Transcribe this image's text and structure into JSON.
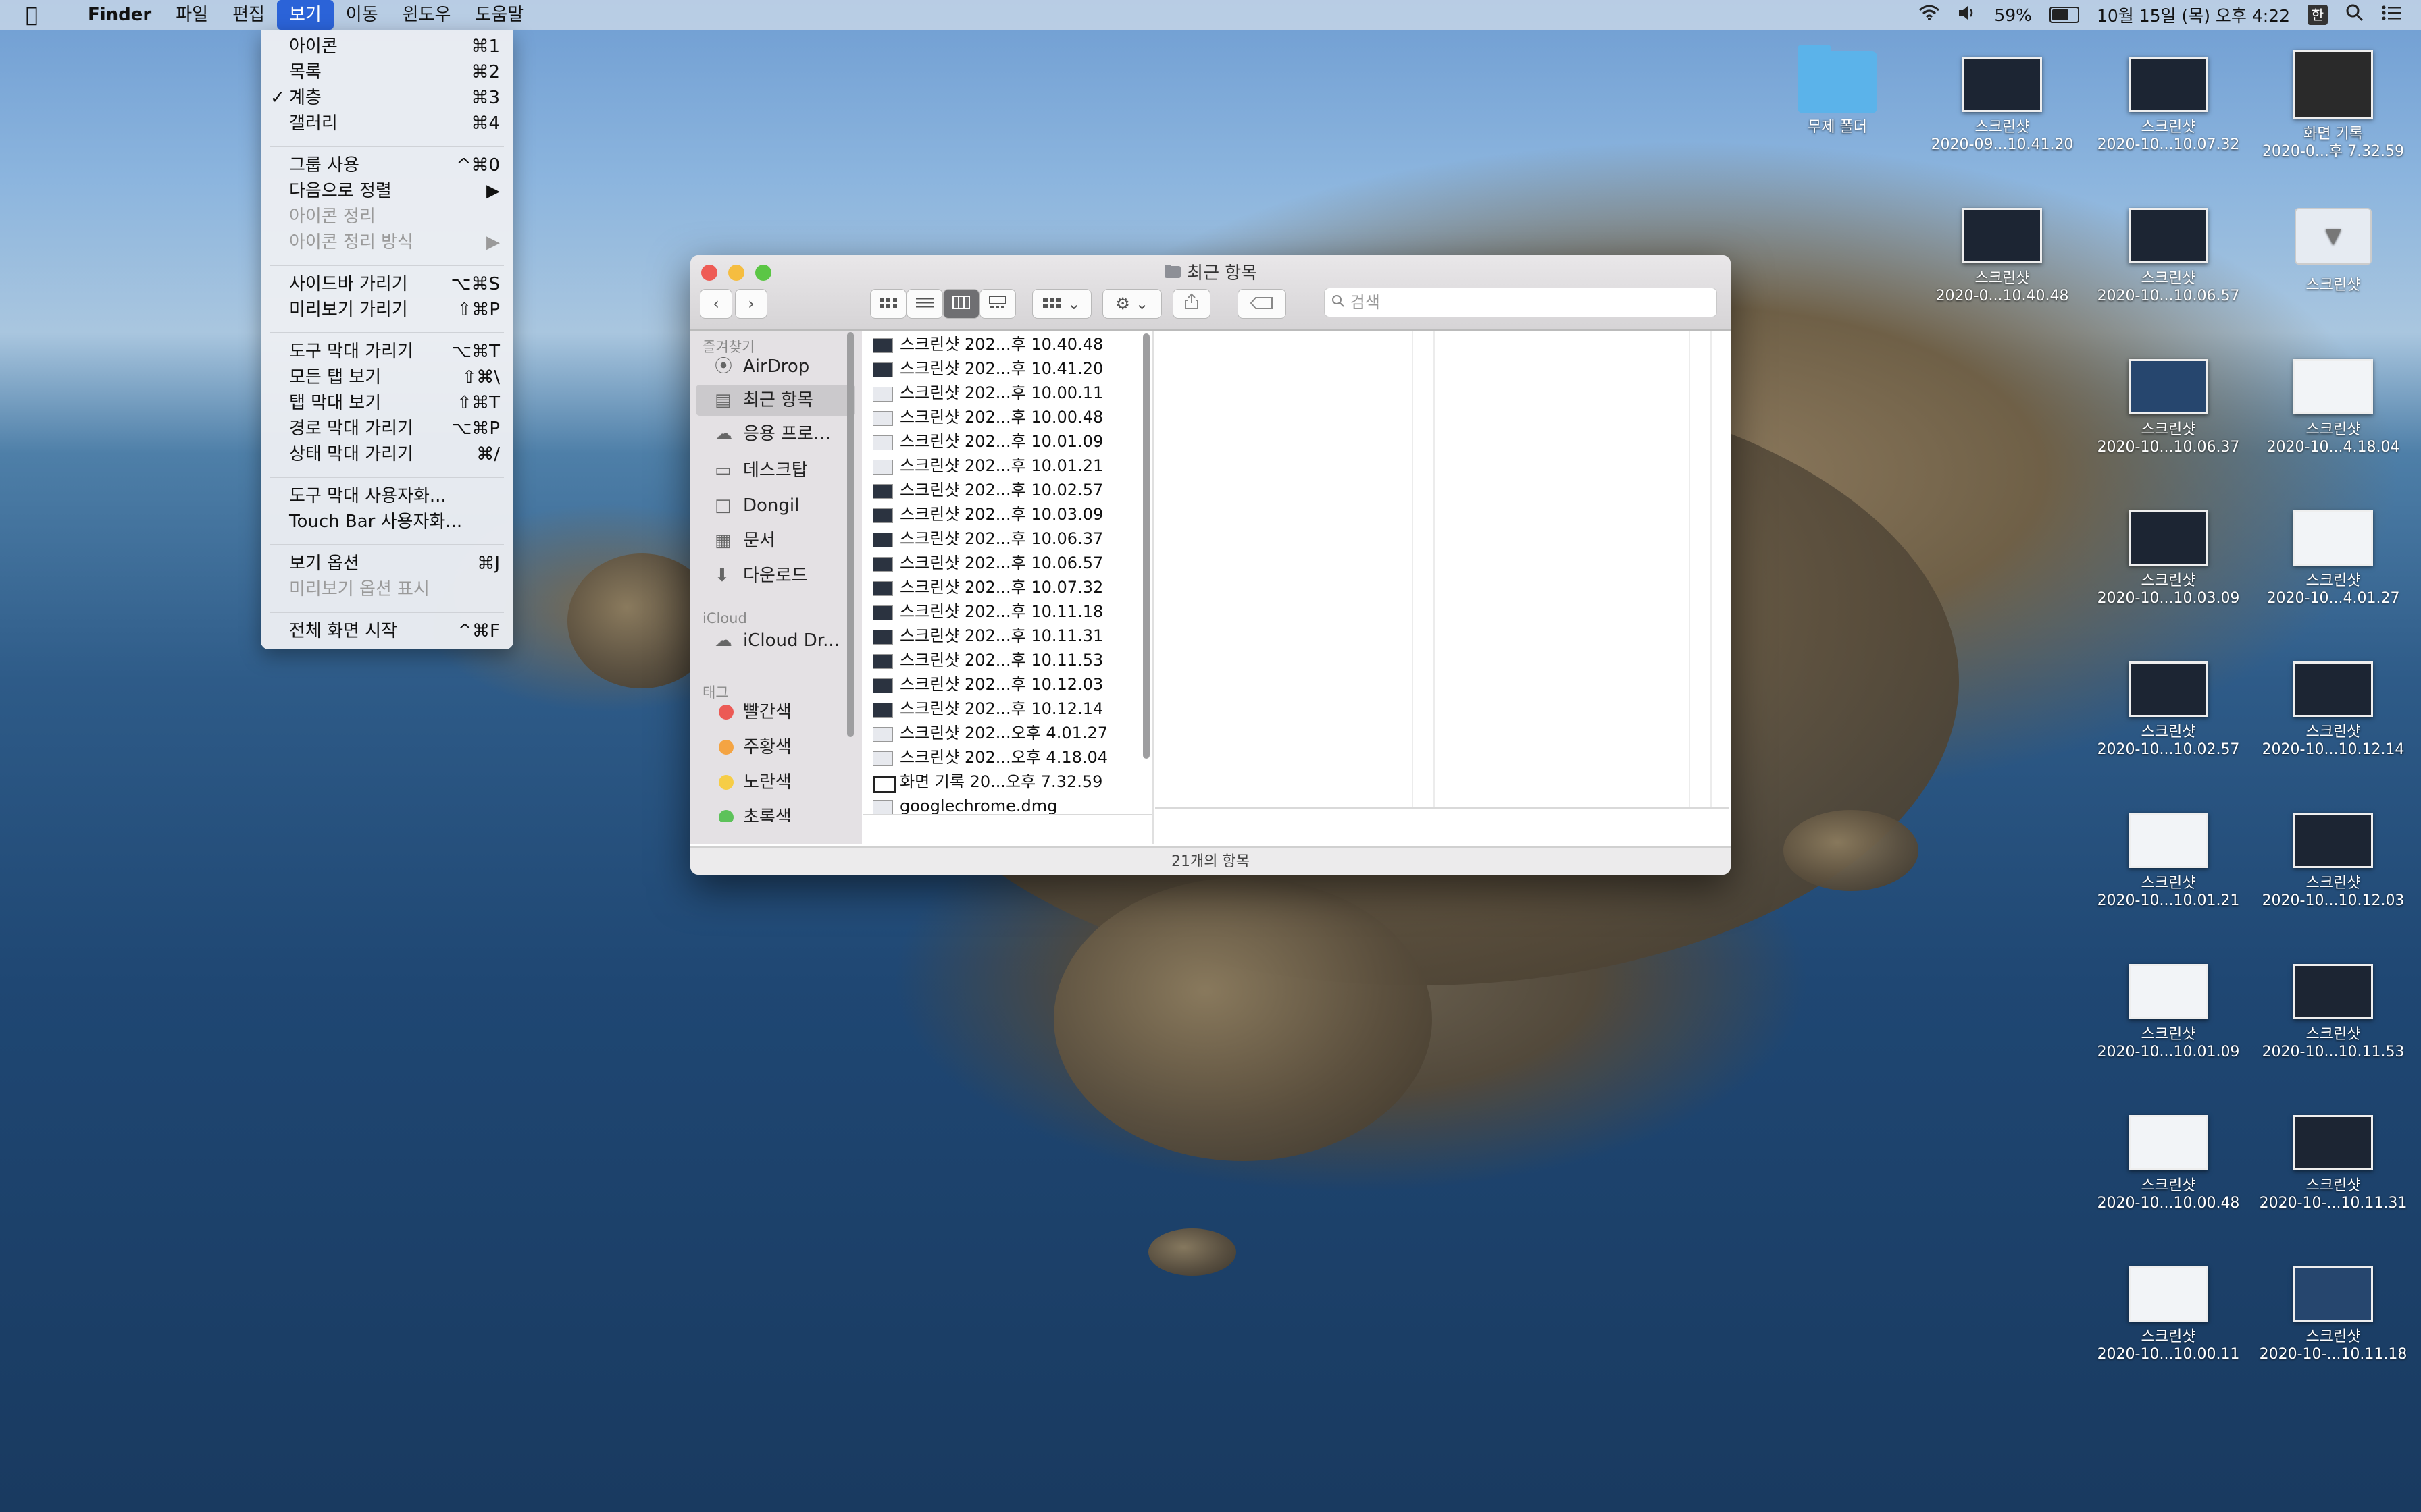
{
  "menubar": {
    "apple": "",
    "items": [
      "Finder",
      "파일",
      "편집",
      "보기",
      "이동",
      "윈도우",
      "도움말"
    ],
    "battery": "59%",
    "clock": "10월 15일 (목) 오후 4:22",
    "input_source": "한"
  },
  "view_menu": {
    "items": [
      {
        "label": "아이콘",
        "shortcut": "⌘1"
      },
      {
        "label": "목록",
        "shortcut": "⌘2"
      },
      {
        "label": "계층",
        "shortcut": "⌘3",
        "checked": "✓"
      },
      {
        "label": "갤러리",
        "shortcut": "⌘4"
      },
      {
        "label": "그룹 사용",
        "shortcut": "^⌘0"
      },
      {
        "label": "다음으로 정렬",
        "shortcut": "▶"
      },
      {
        "label": "아이콘 정리",
        "shortcut": ""
      },
      {
        "label": "아이콘 정리 방식",
        "shortcut": "▶"
      },
      {
        "label": "사이드바 가리기",
        "shortcut": "⌥⌘S"
      },
      {
        "label": "미리보기 가리기",
        "shortcut": "⇧⌘P"
      },
      {
        "label": "도구 막대 가리기",
        "shortcut": "⌥⌘T"
      },
      {
        "label": "모든 탭 보기",
        "shortcut": "⇧⌘\\"
      },
      {
        "label": "탭 막대 보기",
        "shortcut": "⇧⌘T"
      },
      {
        "label": "경로 막대 가리기",
        "shortcut": "⌥⌘P"
      },
      {
        "label": "상태 막대 가리기",
        "shortcut": "⌘/"
      },
      {
        "label": "도구 막대 사용자화...",
        "shortcut": ""
      },
      {
        "label": "Touch Bar 사용자화...",
        "shortcut": ""
      },
      {
        "label": "보기 옵션",
        "shortcut": "⌘J"
      },
      {
        "label": "미리보기 옵션 표시",
        "shortcut": ""
      },
      {
        "label": "전체 화면 시작",
        "shortcut": "^⌘F"
      }
    ]
  },
  "finder": {
    "title": "최근 항목",
    "search_placeholder": "검색",
    "sidebar": {
      "favorites_header": "즐겨찾기",
      "favorites": [
        "AirDrop",
        "최근 항목",
        "응용 프로…",
        "데스크탑",
        "Dongil",
        "문서",
        "다운로드"
      ],
      "icloud_header": "iCloud",
      "icloud": [
        "iCloud Dr..."
      ],
      "tags_header": "태그",
      "tags": [
        "빨간색",
        "주황색",
        "노란색",
        "초록색"
      ],
      "tag_colors": [
        "#ec5a55",
        "#f4a443",
        "#f6cd47",
        "#5dc25a"
      ]
    },
    "files": [
      "스크린샷 202...후 10.40.48",
      "스크린샷 202...후 10.41.20",
      "스크린샷 202...후 10.00.11",
      "스크린샷 202...후 10.00.48",
      "스크린샷 202...후 10.01.09",
      "스크린샷 202...후 10.01.21",
      "스크린샷 202...후 10.02.57",
      "스크린샷 202...후 10.03.09",
      "스크린샷 202...후 10.06.37",
      "스크린샷 202...후 10.06.57",
      "스크린샷 202...후 10.07.32",
      "스크린샷 202...후 10.11.18",
      "스크린샷 202...후 10.11.31",
      "스크린샷 202...후 10.11.53",
      "스크린샷 202...후 10.12.03",
      "스크린샷 202...후 10.12.14",
      "스크린샷 202...오후 4.01.27",
      "스크린샷 202...오후 4.18.04",
      "화면 기록 20...오후 7.32.59",
      "googlechrome.dmg"
    ],
    "status": "21개의 항목"
  },
  "desktop": [
    {
      "l1": "무제 폴더",
      "l2": ""
    },
    {
      "l1": "스크린샷",
      "l2": "2020-09...10.41.20"
    },
    {
      "l1": "스크린샷",
      "l2": "2020-10...10.07.32"
    },
    {
      "l1": "화면 기록",
      "l2": "2020-0...후 7.32.59"
    },
    {
      "l1": "스크린샷",
      "l2": "2020-0...10.40.48"
    },
    {
      "l1": "스크린샷",
      "l2": "2020-10...10.06.57"
    },
    {
      "l1": "스크린샷",
      "l2": ""
    },
    {
      "l1": "스크린샷",
      "l2": "2020-10...10.06.37"
    },
    {
      "l1": "스크린샷",
      "l2": "2020-10...4.18.04"
    },
    {
      "l1": "스크린샷",
      "l2": "2020-10...10.03.09"
    },
    {
      "l1": "스크린샷",
      "l2": "2020-10...4.01.27"
    },
    {
      "l1": "스크린샷",
      "l2": "2020-10...10.02.57"
    },
    {
      "l1": "스크린샷",
      "l2": "2020-10...10.12.14"
    },
    {
      "l1": "스크린샷",
      "l2": "2020-10...10.01.21"
    },
    {
      "l1": "스크린샷",
      "l2": "2020-10...10.12.03"
    },
    {
      "l1": "스크린샷",
      "l2": "2020-10...10.01.09"
    },
    {
      "l1": "스크린샷",
      "l2": "2020-10...10.11.53"
    },
    {
      "l1": "스크린샷",
      "l2": "2020-10...10.00.48"
    },
    {
      "l1": "스크린샷",
      "l2": "2020-10-...10.11.31"
    },
    {
      "l1": "스크린샷",
      "l2": "2020-10...10.00.11"
    },
    {
      "l1": "스크린샷",
      "l2": "2020-10-...10.11.18"
    }
  ]
}
